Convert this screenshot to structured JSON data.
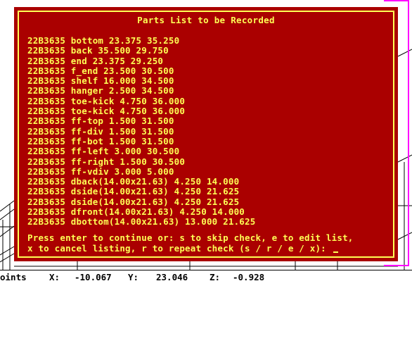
{
  "dialog": {
    "title": "Parts List to be Recorded",
    "parts": [
      "22B3635 bottom 23.375 35.250",
      "22B3635 back 35.500 29.750",
      "22B3635 end 23.375 29.250",
      "22B3635 f_end 23.500 30.500",
      "22B3635 shelf 16.000 34.500",
      "22B3635 hanger 2.500 34.500",
      "22B3635 toe-kick 4.750 36.000",
      "22B3635 toe-kick 4.750 36.000",
      "22B3635 ff-top 1.500 31.500",
      "22B3635 ff-div 1.500 31.500",
      "22B3635 ff-bot 1.500 31.500",
      "22B3635 ff-left 3.000 30.500",
      "22B3635 ff-right 1.500 30.500",
      "22B3635 ff-vdiv 3.000 5.000",
      "22B3635 dback(14.00x21.63) 4.250 14.000",
      "22B3635 dside(14.00x21.63) 4.250 21.625",
      "22B3635 dside(14.00x21.63) 4.250 21.625",
      "22B3635 dfront(14.00x21.63) 4.250 14.000",
      "22B3635 dbottom(14.00x21.63) 13.000 21.625"
    ],
    "prompt_line1": "Press enter to continue or: s to skip check, e to edit list,",
    "prompt_line2": "x to cancel listing, r to repeat check (s / r / e / x): "
  },
  "statusbar": {
    "mode": "oints",
    "x_label": "X:",
    "x_value": "-10.067",
    "y_label": "Y:",
    "y_value": "23.046",
    "z_label": "Z:",
    "z_value": "-0.928"
  },
  "colors": {
    "dialog_bg": "#aa0000",
    "dialog_text": "#ffff55",
    "frame_accent": "#ff00ff"
  }
}
